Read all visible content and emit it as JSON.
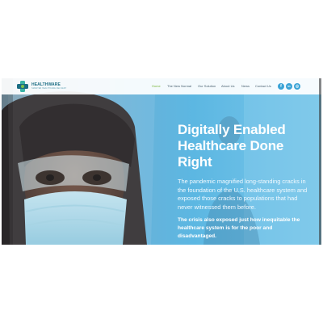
{
  "logo": {
    "name": "HEALTHWARE",
    "sub": "SMARTER HEALTHCARE DELIVERY"
  },
  "nav": {
    "items": [
      {
        "label": "Home",
        "active": true
      },
      {
        "label": "The New Normal",
        "active": false
      },
      {
        "label": "Our Solution",
        "active": false
      },
      {
        "label": "About Us",
        "active": false
      },
      {
        "label": "News",
        "active": false
      },
      {
        "label": "Contact Us",
        "active": false
      }
    ]
  },
  "socials": [
    {
      "icon": "facebook-icon",
      "glyph": "f"
    },
    {
      "icon": "linkedin-icon",
      "glyph": "in"
    },
    {
      "icon": "instagram-icon",
      "glyph": "◎"
    }
  ],
  "hero": {
    "title": "Digitally Enabled Healthcare Done Right",
    "paragraph1": "The pandemic magnified long-standing cracks in the foundation of the U.S. healthcare system and exposed those cracks to populations that had never witnessed them before.",
    "paragraph2": "The crisis also exposed just how inequitable the healthcare system is for the poor and disadvantaged."
  },
  "colors": {
    "accent": "#79b53b",
    "brand": "#1b6d83",
    "social": "#3aa3d6",
    "hero": "#5fb6df"
  }
}
